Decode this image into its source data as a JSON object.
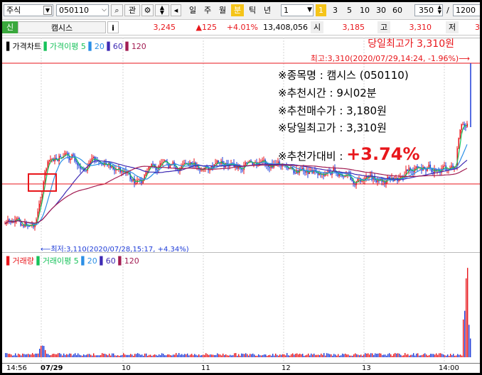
{
  "toolbar": {
    "market": "주식",
    "code": "050110",
    "btn_search": "⌕",
    "btn_watch": "관",
    "periods": [
      "일",
      "주",
      "월",
      "분",
      "틱",
      "년"
    ],
    "selected_period": "분",
    "count": "1",
    "minute_lock": "1",
    "minutes": [
      "3",
      "5",
      "10",
      "30",
      "60"
    ],
    "zoom": "350",
    "slash": "/",
    "total": "1200"
  },
  "quote": {
    "flag": "신",
    "name": "캠시스",
    "info": "i",
    "price": "3,245",
    "change": "▲125",
    "rate": "+4.01%",
    "volume": "13,408,056",
    "open_label": "시",
    "open": "3,185",
    "high_label": "고",
    "high": "3,310",
    "low_label": "저",
    "low": "3"
  },
  "price_legend": {
    "bar_label": "가격차트",
    "ma_label": "가격이평",
    "ma5": "5",
    "ma20": "20",
    "ma60": "60",
    "ma120": "120"
  },
  "annotations": {
    "top_title": "당일최고가 3,310원",
    "max_note": "최고:3,310(2020/07/29,14:24, -1.96%)⟶",
    "line1": "※종목명 : 캠시스 (050110)",
    "line2": "※추천시간 : 9시02분",
    "line3": "※추천매수가 : 3,180원",
    "line4": "※당일최고가 : 3,310원",
    "line5_label": "※추천가대비 : ",
    "line5_value": "+3.74%",
    "min_note": "⟵최저:3,110(2020/07/28,15:17, +4.34%)"
  },
  "volume_legend": {
    "bar_label": "거래량",
    "ma_label": "거래이평",
    "ma5": "5",
    "ma20": "20",
    "ma60": "60",
    "ma120": "120"
  },
  "xaxis": [
    "14:56",
    "07/29",
    "10",
    "11",
    "12",
    "13",
    "14:00"
  ],
  "colors": {
    "up": "#e8161b",
    "down": "#1e3cd8",
    "ma5": "#17c25a",
    "ma20": "#2b8fe6",
    "ma60": "#3f2bb4",
    "ma120": "#a21c52",
    "selected": "#f5c419"
  }
}
